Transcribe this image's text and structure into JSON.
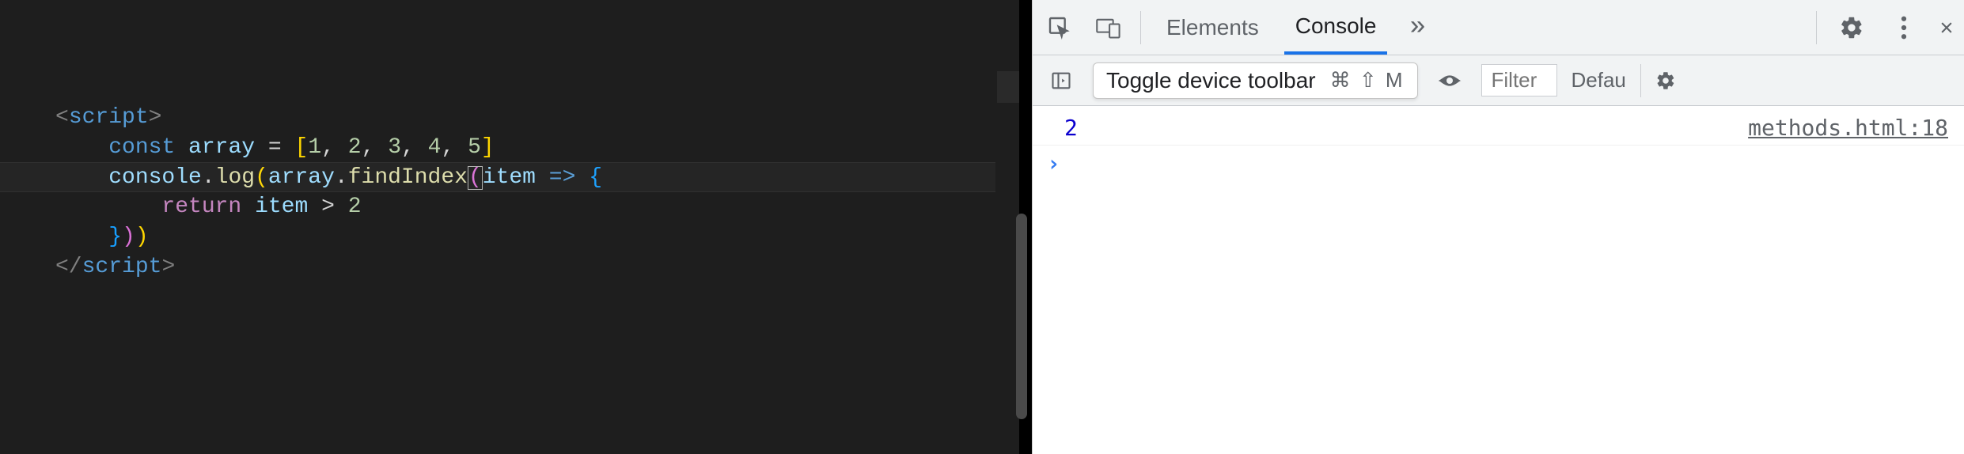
{
  "editor": {
    "code_lines": [
      {
        "indent": 0,
        "tokens": [
          {
            "t": "angle",
            "v": "<"
          },
          {
            "t": "tag",
            "v": "script"
          },
          {
            "t": "angle",
            "v": ">"
          }
        ]
      },
      {
        "indent": 1,
        "tokens": [
          {
            "t": "keyword",
            "v": "const"
          },
          {
            "t": "plain",
            "v": " "
          },
          {
            "t": "var",
            "v": "array"
          },
          {
            "t": "plain",
            "v": " "
          },
          {
            "t": "punct",
            "v": "="
          },
          {
            "t": "plain",
            "v": " "
          },
          {
            "t": "bracket-y",
            "v": "["
          },
          {
            "t": "number",
            "v": "1"
          },
          {
            "t": "punct",
            "v": ","
          },
          {
            "t": "plain",
            "v": " "
          },
          {
            "t": "number",
            "v": "2"
          },
          {
            "t": "punct",
            "v": ","
          },
          {
            "t": "plain",
            "v": " "
          },
          {
            "t": "number",
            "v": "3"
          },
          {
            "t": "punct",
            "v": ","
          },
          {
            "t": "plain",
            "v": " "
          },
          {
            "t": "number",
            "v": "4"
          },
          {
            "t": "punct",
            "v": ","
          },
          {
            "t": "plain",
            "v": " "
          },
          {
            "t": "number",
            "v": "5"
          },
          {
            "t": "bracket-y",
            "v": "]"
          }
        ]
      },
      {
        "indent": 1,
        "tokens": [
          {
            "t": "var",
            "v": "console"
          },
          {
            "t": "punct",
            "v": "."
          },
          {
            "t": "func",
            "v": "log"
          },
          {
            "t": "bracket-y",
            "v": "("
          },
          {
            "t": "var",
            "v": "array"
          },
          {
            "t": "punct",
            "v": "."
          },
          {
            "t": "func",
            "v": "findIndex"
          },
          {
            "t": "bracket-p-cursor",
            "v": "("
          },
          {
            "t": "var",
            "v": "item"
          },
          {
            "t": "plain",
            "v": " "
          },
          {
            "t": "keyword",
            "v": "=>"
          },
          {
            "t": "plain",
            "v": " "
          },
          {
            "t": "bracket-b",
            "v": "{"
          }
        ]
      },
      {
        "indent": 2,
        "tokens": [
          {
            "t": "return",
            "v": "return"
          },
          {
            "t": "plain",
            "v": " "
          },
          {
            "t": "var",
            "v": "item"
          },
          {
            "t": "plain",
            "v": " "
          },
          {
            "t": "op",
            "v": ">"
          },
          {
            "t": "plain",
            "v": " "
          },
          {
            "t": "number",
            "v": "2"
          }
        ]
      },
      {
        "indent": 1,
        "tokens": [
          {
            "t": "bracket-b",
            "v": "}"
          },
          {
            "t": "bracket-p",
            "v": ")"
          },
          {
            "t": "bracket-y",
            "v": ")"
          }
        ]
      },
      {
        "indent": 0,
        "tokens": [
          {
            "t": "angle",
            "v": "</"
          },
          {
            "t": "tag",
            "v": "script"
          },
          {
            "t": "angle",
            "v": ">"
          }
        ]
      }
    ]
  },
  "devtools": {
    "tabs": {
      "elements": "Elements",
      "console": "Console"
    },
    "tooltip": {
      "label": "Toggle device toolbar",
      "shortcut": "⌘ ⇧ M"
    },
    "filter_placeholder": "Filter",
    "levels_label": "Defau",
    "console_output": {
      "value": "2",
      "source": "methods.html:18"
    },
    "prompt_caret": "›"
  }
}
